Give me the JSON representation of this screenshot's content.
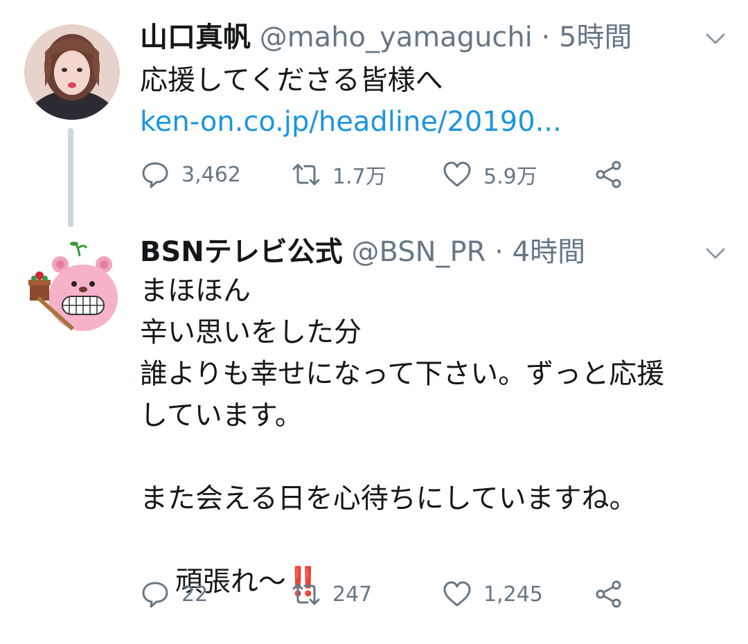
{
  "tweets": [
    {
      "display_name": "山口真帆",
      "handle": "@maho_yamaguchi",
      "separator": "·",
      "time": "5時間",
      "text": "応援してくださる皆様へ",
      "link": "ken-on.co.jp/headline/20190...",
      "replies": "3,462",
      "retweets": "1.7万",
      "likes": "5.9万"
    },
    {
      "display_name": "BSNテレビ公式",
      "handle": "@BSN_PR",
      "separator": "·",
      "time": "4時間",
      "text_lines": "まほほん\n辛い思いをした分\n誰よりも幸せになって下さい。ずっと応援\nしています。\n\nまた会える日を心待ちにしていますね。",
      "text_last": "頑張れ～",
      "emoji": "‼️",
      "replies": "22",
      "retweets": "247",
      "likes": "1,245"
    }
  ],
  "icons": [
    "reply-icon",
    "retweet-icon",
    "like-icon",
    "share-icon",
    "chevron-down-icon"
  ],
  "colors": {
    "link": "#1b95e0",
    "meta": "#657786",
    "thread_line": "#ccd6dd",
    "emoji": "#e0245e"
  }
}
